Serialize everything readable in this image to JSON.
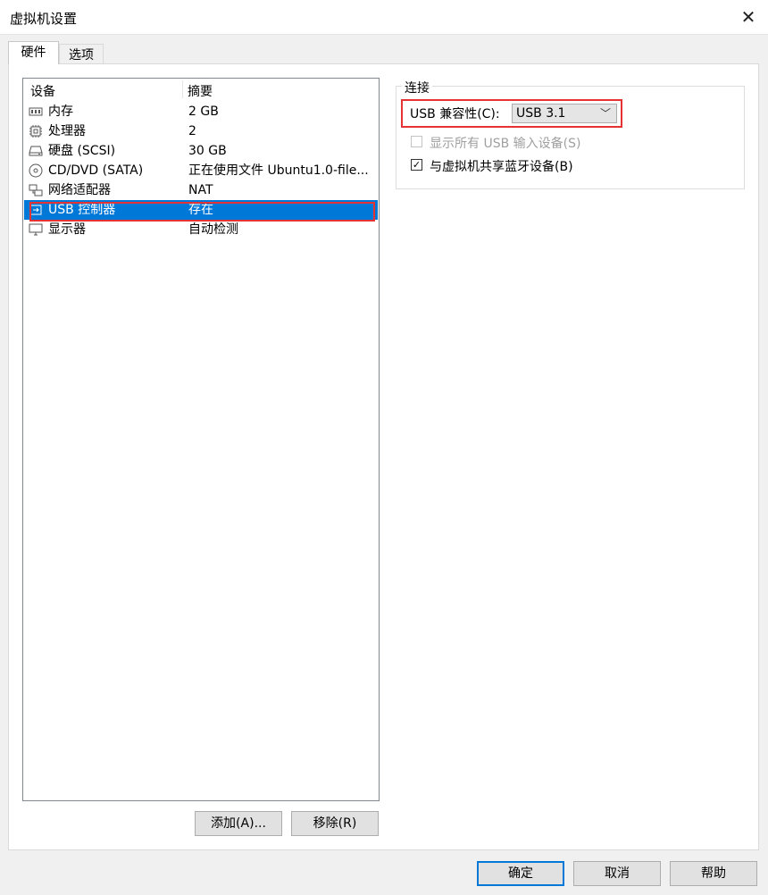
{
  "window": {
    "title": "虚拟机设置"
  },
  "tabs": [
    {
      "label": "硬件",
      "active": true
    },
    {
      "label": "选项",
      "active": false
    }
  ],
  "device_list": {
    "columns": [
      "设备",
      "摘要"
    ],
    "rows": [
      {
        "device": "内存",
        "summary": "2 GB",
        "icon": "memory-icon"
      },
      {
        "device": "处理器",
        "summary": "2",
        "icon": "processor-icon"
      },
      {
        "device": "硬盘 (SCSI)",
        "summary": "30 GB",
        "icon": "hard-disk-icon"
      },
      {
        "device": "CD/DVD (SATA)",
        "summary": "正在使用文件 Ubuntu1.0-file...",
        "icon": "cd-dvd-icon"
      },
      {
        "device": "网络适配器",
        "summary": "NAT",
        "icon": "network-adapter-icon"
      },
      {
        "device": "USB 控制器",
        "summary": "存在",
        "icon": "usb-controller-icon",
        "selected": true
      },
      {
        "device": "显示器",
        "summary": "自动检测",
        "icon": "display-icon"
      }
    ]
  },
  "list_buttons": {
    "add": "添加(A)...",
    "remove": "移除(R)"
  },
  "connection": {
    "group_label": "连接",
    "usb_compat_label": "USB 兼容性(C):",
    "usb_compat_value": "USB 3.1",
    "show_all_usb_label": "显示所有 USB 输入设备(S)",
    "show_all_usb_checked": false,
    "share_bluetooth_label": "与虚拟机共享蓝牙设备(B)",
    "share_bluetooth_checked": true
  },
  "dialog_buttons": {
    "ok": "确定",
    "cancel": "取消",
    "help": "帮助"
  },
  "colors": {
    "selection": "#0078d7",
    "highlight_box": "#e53333"
  }
}
